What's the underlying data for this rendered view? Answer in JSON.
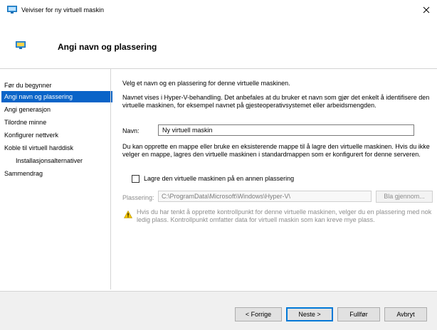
{
  "window": {
    "title": "Veiviser for ny virtuell maskin"
  },
  "header": {
    "title": "Angi navn og plassering"
  },
  "nav": {
    "items": [
      {
        "label": "Før du begynner",
        "active": false
      },
      {
        "label": "Angi navn og plassering",
        "active": true
      },
      {
        "label": "Angi generasjon",
        "active": false
      },
      {
        "label": "Tilordne minne",
        "active": false
      },
      {
        "label": "Konfigurer nettverk",
        "active": false
      },
      {
        "label": "Koble til virtuell harddisk",
        "active": false
      },
      {
        "label": "Installasjonsalternativer",
        "active": false,
        "sub": true
      },
      {
        "label": "Sammendrag",
        "active": false
      }
    ]
  },
  "main": {
    "intro": "Velg et navn og en plassering for denne virtuelle maskinen.",
    "name_help": "Navnet vises i Hyper-V-behandling. Det anbefales at du bruker et navn som gjør det enkelt å identifisere den virtuelle maskinen, for eksempel navnet på gjesteoperativsystemet eller arbeidsmengden.",
    "name_label": "Navn:",
    "name_value": "Ny virtuell maskin",
    "folder_help": "Du kan opprette en mappe eller bruke en eksisterende mappe til å lagre den virtuelle maskinen. Hvis du ikke velger en mappe, lagres den virtuelle maskinen i standardmappen som er konfigurert for denne serveren.",
    "checkbox_label": "Lagre den virtuelle maskinen på en annen plassering",
    "checkbox_checked": false,
    "location_label": "Plassering:",
    "location_value": "C:\\ProgramData\\Microsoft\\Windows\\Hyper-V\\",
    "browse_label": "Bla gjennom...",
    "warning": "Hvis du har tenkt å opprette kontrollpunkt for denne virtuelle maskinen, velger du en plassering med nok ledig plass. Kontrollpunkt omfatter data for virtuell maskin som kan kreve mye plass."
  },
  "footer": {
    "prev_label": "< Forrige",
    "next_label": "Neste >",
    "finish_label": "Fullfør",
    "cancel_label": "Avbryt"
  },
  "icons": {
    "app": "virtual-machine-icon",
    "close": "close-icon",
    "warning": "warning-icon"
  },
  "colors": {
    "accent": "#0a64c8",
    "default_button_border": "#0078d7",
    "footer_bg": "#f0f0f0",
    "disabled_text": "#8d8d8d"
  }
}
